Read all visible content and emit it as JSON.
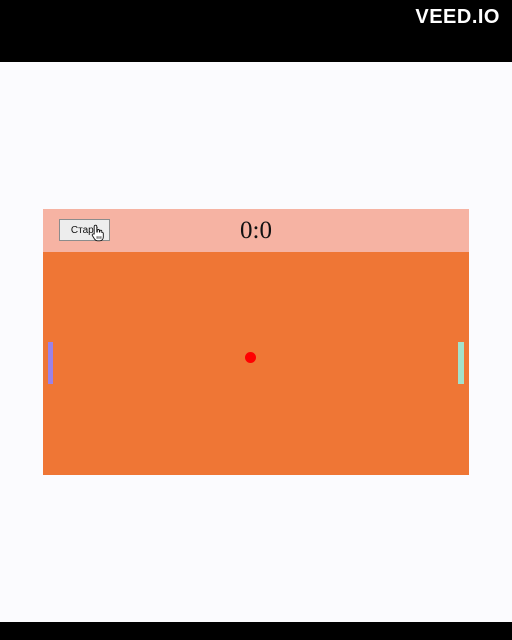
{
  "watermark": "VEED.IO",
  "header": {
    "start_label": "Старт",
    "score": "0:0"
  },
  "colors": {
    "header_bg": "#f6b3a3",
    "field_bg": "#ef7635",
    "left_paddle": "#9b82e6",
    "right_paddle": "#a3e2cc",
    "ball": "#ff0000"
  }
}
